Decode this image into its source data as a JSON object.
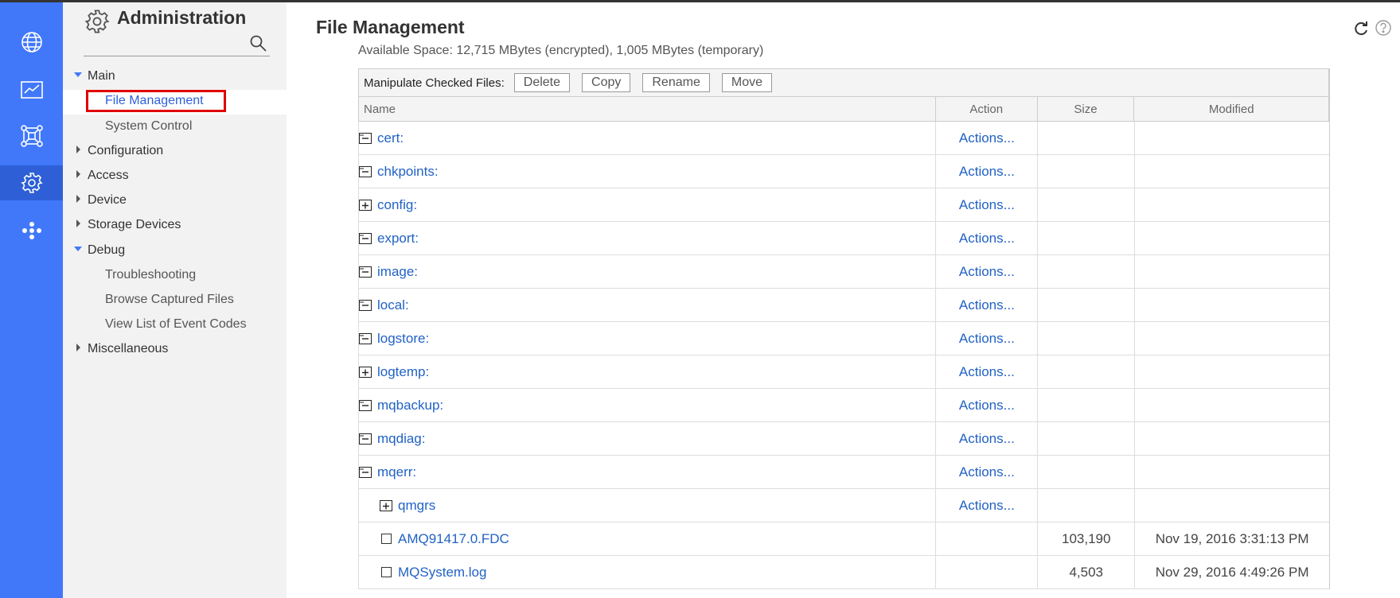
{
  "nav": {
    "title": "Administration",
    "sections": {
      "main": "Main",
      "file_management": "File Management",
      "system_control": "System Control",
      "configuration": "Configuration",
      "access": "Access",
      "device": "Device",
      "storage_devices": "Storage Devices",
      "debug": "Debug",
      "troubleshooting": "Troubleshooting",
      "browse_captured_files": "Browse Captured Files",
      "view_event_codes": "View List of Event Codes",
      "miscellaneous": "Miscellaneous"
    }
  },
  "rail": {
    "icons": [
      "globe-icon",
      "monitor-chart-icon",
      "network-icon",
      "gear-icon",
      "blockchain-icon"
    ],
    "active": "gear-icon",
    "accent": "#4178fa"
  },
  "main": {
    "title": "File Management",
    "available_space": "Available Space: 12,715 MBytes (encrypted), 1,005 MBytes (temporary)"
  },
  "toolbar": {
    "label": "Manipulate Checked Files:",
    "delete": "Delete",
    "copy": "Copy",
    "rename": "Rename",
    "move": "Move"
  },
  "table": {
    "headers": {
      "name": "Name",
      "action": "Action",
      "size": "Size",
      "modified": "Modified"
    },
    "rows": [
      {
        "name": "cert:",
        "action": "Actions...",
        "size": "",
        "modified": ""
      },
      {
        "name": "chkpoints:",
        "action": "Actions...",
        "size": "",
        "modified": ""
      },
      {
        "name": "config:",
        "action": "Actions...",
        "size": "",
        "modified": ""
      },
      {
        "name": "export:",
        "action": "Actions...",
        "size": "",
        "modified": ""
      },
      {
        "name": "image:",
        "action": "Actions...",
        "size": "",
        "modified": ""
      },
      {
        "name": "local:",
        "action": "Actions...",
        "size": "",
        "modified": ""
      },
      {
        "name": "logstore:",
        "action": "Actions...",
        "size": "",
        "modified": ""
      },
      {
        "name": "logtemp:",
        "action": "Actions...",
        "size": "",
        "modified": ""
      },
      {
        "name": "mqbackup:",
        "action": "Actions...",
        "size": "",
        "modified": ""
      },
      {
        "name": "mqdiag:",
        "action": "Actions...",
        "size": "",
        "modified": ""
      },
      {
        "name": "mqerr:",
        "action": "Actions...",
        "size": "",
        "modified": ""
      },
      {
        "name": "qmgrs",
        "action": "Actions...",
        "size": "",
        "modified": ""
      },
      {
        "name": "AMQ91417.0.FDC",
        "action": "",
        "size": "103,190",
        "modified": "Nov 19, 2016 3:31:13 PM"
      },
      {
        "name": "MQSystem.log",
        "action": "",
        "size": "4,503",
        "modified": "Nov 29, 2016 4:49:26 PM"
      }
    ]
  }
}
